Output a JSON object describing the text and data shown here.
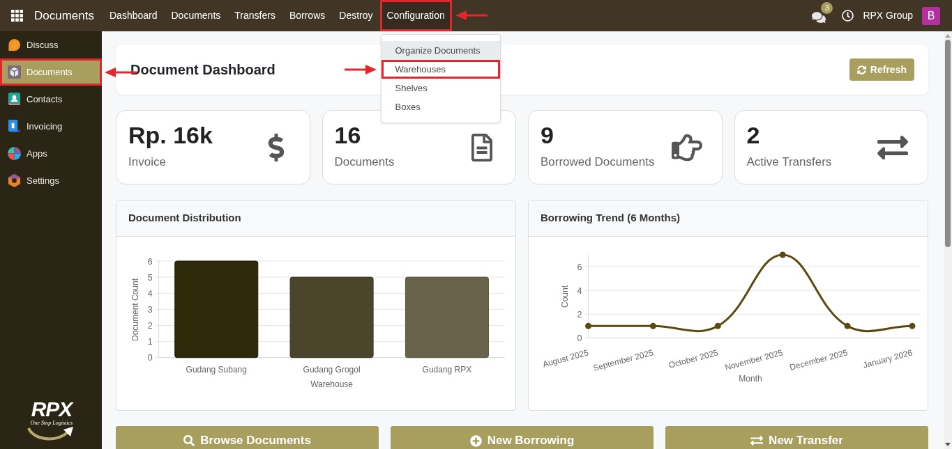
{
  "topbar": {
    "brand": "Documents",
    "nav": [
      {
        "label": "Dashboard",
        "highlighted": false,
        "expanded": false
      },
      {
        "label": "Documents",
        "highlighted": false,
        "expanded": false
      },
      {
        "label": "Transfers",
        "highlighted": false,
        "expanded": false
      },
      {
        "label": "Borrows",
        "highlighted": false,
        "expanded": false
      },
      {
        "label": "Destroy",
        "highlighted": false,
        "expanded": false
      },
      {
        "label": "Configuration",
        "highlighted": true,
        "expanded": true,
        "menu": [
          {
            "label": "Organize Documents",
            "selected": true,
            "highlighted": false
          },
          {
            "label": "Warehouses",
            "selected": false,
            "highlighted": true
          },
          {
            "label": "Shelves",
            "selected": false,
            "highlighted": false
          },
          {
            "label": "Boxes",
            "selected": false,
            "highlighted": false
          }
        ]
      }
    ],
    "messages_badge": "3",
    "company": "RPX Group",
    "avatar": "B"
  },
  "sidebar": {
    "items": [
      {
        "label": "Discuss",
        "kind": "discuss",
        "selected": false,
        "highlighted": false
      },
      {
        "label": "Documents",
        "kind": "documents",
        "selected": true,
        "highlighted": true
      },
      {
        "label": "Contacts",
        "kind": "contacts",
        "selected": false,
        "highlighted": false
      },
      {
        "label": "Invoicing",
        "kind": "invoicing",
        "selected": false,
        "highlighted": false
      },
      {
        "label": "Apps",
        "kind": "apps",
        "selected": false,
        "highlighted": false
      },
      {
        "label": "Settings",
        "kind": "settings",
        "selected": false,
        "highlighted": false
      }
    ],
    "logo": {
      "wordmark": "RPX",
      "tagline": "One Stop Logistics"
    }
  },
  "header": {
    "title": "Document Dashboard",
    "refresh_button": "Refresh"
  },
  "stats": [
    {
      "value": "Rp. 16k",
      "label": "Invoice",
      "kind": "invoice"
    },
    {
      "value": "16",
      "label": "Documents",
      "kind": "documents"
    },
    {
      "value": "9",
      "label": "Borrowed Documents",
      "kind": "borrowed"
    },
    {
      "value": "2",
      "label": "Active Transfers",
      "kind": "transfers"
    }
  ],
  "charts": [
    {
      "title": "Document Distribution",
      "chart_data": {
        "type": "bar",
        "xlabel": "Warehouse",
        "ylabel": "Document Count",
        "categories": [
          "Gudang Subang",
          "Gudang Grogol",
          "Gudang RPX"
        ],
        "values": [
          6,
          5,
          5
        ],
        "ylim": [
          0,
          6
        ],
        "yticks": [
          0,
          1,
          2,
          3,
          4,
          5,
          6
        ],
        "grid": true
      }
    },
    {
      "title": "Borrowing Trend (6 Months)",
      "chart_data": {
        "type": "line",
        "xlabel": "Month",
        "ylabel": "Count",
        "categories": [
          "August 2025",
          "September 2025",
          "October 2025",
          "November 2025",
          "December 2025",
          "January 2026"
        ],
        "values": [
          1,
          1,
          1,
          7,
          1,
          1
        ],
        "ylim": [
          0,
          7
        ],
        "yticks": [
          0,
          2,
          4,
          6
        ],
        "grid": true,
        "marker": true
      }
    }
  ],
  "quick_actions": [
    {
      "label": "Browse Documents",
      "kind": "browse"
    },
    {
      "label": "New Borrowing",
      "kind": "borrow"
    },
    {
      "label": "New Transfer",
      "kind": "transfer"
    }
  ]
}
